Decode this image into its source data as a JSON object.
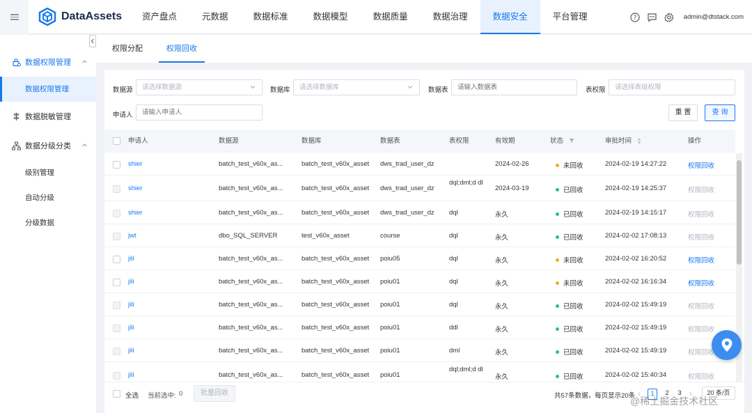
{
  "app": {
    "name": "DataAssets",
    "user": "admin@dtstack.com"
  },
  "nav": [
    {
      "label": "资产盘点"
    },
    {
      "label": "元数据"
    },
    {
      "label": "数据标准"
    },
    {
      "label": "数据模型"
    },
    {
      "label": "数据质量"
    },
    {
      "label": "数据治理"
    },
    {
      "label": "数据安全",
      "active": true
    },
    {
      "label": "平台管理"
    }
  ],
  "sidebar": {
    "groups": [
      {
        "label": "数据权限管理",
        "expanded": true,
        "items": [
          {
            "label": "数据权限管理",
            "active": true
          }
        ]
      },
      {
        "label": "数据脱敏管理",
        "expanded": false,
        "items": []
      },
      {
        "label": "数据分级分类",
        "expanded": true,
        "items": [
          {
            "label": "级别管理"
          },
          {
            "label": "自动分级"
          },
          {
            "label": "分级数据"
          }
        ]
      }
    ]
  },
  "tabs": [
    {
      "label": "权限分配"
    },
    {
      "label": "权限回收",
      "active": true
    }
  ],
  "filters": {
    "datasource": {
      "label": "数据源",
      "placeholder": "请选择数据源"
    },
    "database": {
      "label": "数据库",
      "placeholder": "请选择数据库"
    },
    "table": {
      "label": "数据表",
      "placeholder": "请输入数据表"
    },
    "permission": {
      "label": "表权限",
      "placeholder": "请选择表级权限"
    },
    "applicant": {
      "label": "申请人",
      "placeholder": "请输入申请人"
    },
    "reset_label": "重 置",
    "query_label": "查 询"
  },
  "table": {
    "headers": [
      "申请人",
      "数据源",
      "数据库",
      "数据表",
      "表权限",
      "有效期",
      "状态",
      "审批时间",
      "操作"
    ],
    "rows": [
      {
        "applicant": "shier",
        "source": "batch_test_v60x_as...",
        "db": "batch_test_v60x_asset",
        "table": "dws_trad_user_dz",
        "perm": "",
        "valid": "2024-02-26",
        "status": "未回收",
        "time": "2024-02-19 14:27:22",
        "action": "权限回收",
        "revoked": false
      },
      {
        "applicant": "shier",
        "source": "batch_test_v60x_as...",
        "db": "batch_test_v60x_asset",
        "table": "dws_trad_user_dz",
        "perm": "dql;dml;d dl",
        "valid": "2024-03-19",
        "status": "已回收",
        "time": "2024-02-19 14:25:37",
        "action": "权限回收",
        "revoked": true
      },
      {
        "applicant": "shier",
        "source": "batch_test_v60x_as...",
        "db": "batch_test_v60x_asset",
        "table": "dws_trad_user_dz",
        "perm": "dql",
        "valid": "永久",
        "status": "已回收",
        "time": "2024-02-19 14:15:17",
        "action": "权限回收",
        "revoked": true
      },
      {
        "applicant": "jwt",
        "source": "dbo_SQL_SERVER",
        "db": "test_v60x_asset",
        "table": "course",
        "perm": "dql",
        "valid": "永久",
        "status": "已回收",
        "time": "2024-02-02 17:08:13",
        "action": "权限回收",
        "revoked": true
      },
      {
        "applicant": "jili",
        "source": "batch_test_v60x_as...",
        "db": "batch_test_v60x_asset",
        "table": "poiu05",
        "perm": "dql",
        "valid": "永久",
        "status": "未回收",
        "time": "2024-02-02 16:20:52",
        "action": "权限回收",
        "revoked": false
      },
      {
        "applicant": "jili",
        "source": "batch_test_v60x_as...",
        "db": "batch_test_v60x_asset",
        "table": "poiu01",
        "perm": "dql",
        "valid": "永久",
        "status": "未回收",
        "time": "2024-02-02 16:16:34",
        "action": "权限回收",
        "revoked": false
      },
      {
        "applicant": "jili",
        "source": "batch_test_v60x_as...",
        "db": "batch_test_v60x_asset",
        "table": "poiu01",
        "perm": "dql",
        "valid": "永久",
        "status": "已回收",
        "time": "2024-02-02 15:49:19",
        "action": "权限回收",
        "revoked": true
      },
      {
        "applicant": "jili",
        "source": "batch_test_v60x_as...",
        "db": "batch_test_v60x_asset",
        "table": "poiu01",
        "perm": "ddl",
        "valid": "永久",
        "status": "已回收",
        "time": "2024-02-02 15:49:19",
        "action": "权限回收",
        "revoked": true
      },
      {
        "applicant": "jili",
        "source": "batch_test_v60x_as...",
        "db": "batch_test_v60x_asset",
        "table": "poiu01",
        "perm": "dml",
        "valid": "永久",
        "status": "已回收",
        "time": "2024-02-02 15:49:19",
        "action": "权限回收",
        "revoked": true
      },
      {
        "applicant": "jili",
        "source": "batch_test_v60x_as...",
        "db": "batch_test_v60x_asset",
        "table": "poiu01",
        "perm": "dql;dml;d dl",
        "valid": "永久",
        "status": "已回收",
        "time": "2024-02-02 15:40:34",
        "action": "权限回收",
        "revoked": true
      }
    ]
  },
  "footer": {
    "select_all": "全选",
    "selected_text": "当前选中:",
    "selected_count": "0",
    "batch_label": "批量回收",
    "summary": "共57条数据，每页显示20条",
    "pages": [
      "1",
      "2",
      "3"
    ],
    "page_size": "20 条/页"
  },
  "colors": {
    "accent": "#1a78ec",
    "pending": "#f5a623",
    "revoked": "#2bbf8a"
  },
  "watermark": "@稀土掘金技术社区"
}
